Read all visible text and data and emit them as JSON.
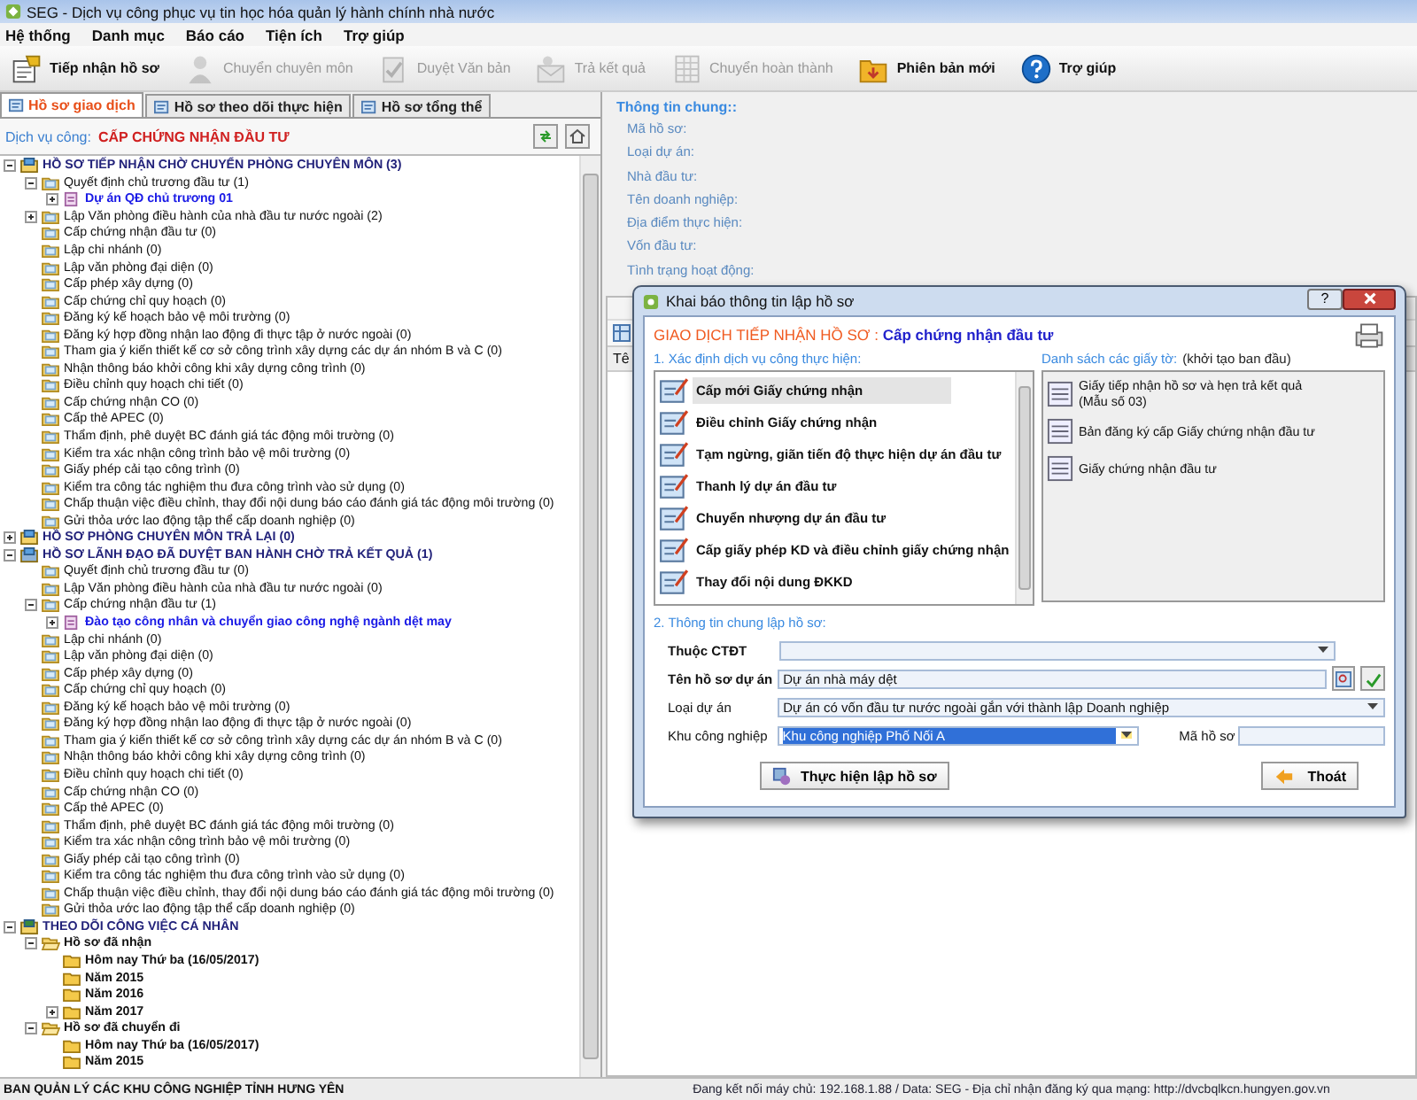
{
  "window": {
    "title": "SEG - Dịch vụ công phục vụ tin học hóa quản lý hành chính nhà nước"
  },
  "menu": [
    "Hệ thống",
    "Danh mục",
    "Báo cáo",
    "Tiện ích",
    "Trợ giúp"
  ],
  "toolbar": [
    {
      "label": "Tiếp nhận hồ sơ",
      "disabled": false
    },
    {
      "label": "Chuyển chuyên môn",
      "disabled": true
    },
    {
      "label": "Duyệt Văn bản",
      "disabled": true
    },
    {
      "label": "Trả kết quả",
      "disabled": true
    },
    {
      "label": "Chuyển hoàn thành",
      "disabled": true
    },
    {
      "label": "Phiên bản mới",
      "disabled": false
    },
    {
      "label": "Trợ giúp",
      "disabled": false
    }
  ],
  "tabs": [
    {
      "label": "Hồ sơ giao dịch",
      "selected": true
    },
    {
      "label": "Hồ sơ theo dõi thực hiện",
      "selected": false
    },
    {
      "label": "Hồ sơ tổng thể",
      "selected": false
    }
  ],
  "service": {
    "label": "Dịch vụ công:",
    "value": "CẤP CHỨNG NHẬN ĐẦU TƯ"
  },
  "tree": {
    "nodes": [
      {
        "label": "HỒ SƠ TIẾP NHẬN CHỜ CHUYỂN PHÒNG CHUYÊN MÔN (3)",
        "kind": "group",
        "expanded": true,
        "children": [
          {
            "label": "Quyết định chủ trương đầu tư (1)",
            "kind": "folder",
            "expanded": true,
            "children": [
              {
                "label": "Dự án QĐ chủ trương 01",
                "kind": "record",
                "expanded": false
              }
            ]
          },
          {
            "label": "Lập Văn phòng điều hành của nhà đầu tư nước ngoài (2)",
            "kind": "folder",
            "expanded": false
          },
          {
            "label": "Cấp chứng nhận đầu tư (0)",
            "kind": "folder"
          },
          {
            "label": "Lập chi nhánh (0)",
            "kind": "folder"
          },
          {
            "label": "Lập văn phòng đại diện (0)",
            "kind": "folder"
          },
          {
            "label": "Cấp phép xây dựng (0)",
            "kind": "folder"
          },
          {
            "label": "Cấp chứng chỉ quy hoạch (0)",
            "kind": "folder"
          },
          {
            "label": "Đăng ký kế hoạch bảo vệ môi trường (0)",
            "kind": "folder"
          },
          {
            "label": "Đăng ký hợp đồng nhận lao động đi thực tập ở nước ngoài (0)",
            "kind": "folder"
          },
          {
            "label": "Tham gia ý kiến thiết kế cơ sở công trình xây dựng các dự án nhóm B và C (0)",
            "kind": "folder"
          },
          {
            "label": "Nhận thông báo khởi công khi xây dựng công trình (0)",
            "kind": "folder"
          },
          {
            "label": "Điều chỉnh quy hoạch chi tiết (0)",
            "kind": "folder"
          },
          {
            "label": "Cấp chứng nhận CO (0)",
            "kind": "folder"
          },
          {
            "label": "Cấp thẻ APEC (0)",
            "kind": "folder"
          },
          {
            "label": "Thẩm định, phê duyệt BC đánh giá tác động môi trường (0)",
            "kind": "folder"
          },
          {
            "label": "Kiểm tra xác nhận công trình bảo vệ môi trường (0)",
            "kind": "folder"
          },
          {
            "label": "Giấy phép cải tạo công trình (0)",
            "kind": "folder"
          },
          {
            "label": "Kiểm tra công tác nghiệm thu đưa công trình vào sử dụng (0)",
            "kind": "folder"
          },
          {
            "label": "Chấp thuận việc điều chỉnh, thay đổi nội dung báo cáo đánh giá tác động môi trường (0)",
            "kind": "folder"
          },
          {
            "label": "Gửi thỏa ước lao động tập thể cấp doanh nghiệp (0)",
            "kind": "folder"
          }
        ]
      },
      {
        "label": "HỒ SƠ PHÒNG CHUYÊN MÔN TRẢ LẠI (0)",
        "kind": "group",
        "expanded": false
      },
      {
        "label": "HỒ SƠ LÃNH ĐẠO ĐÃ DUYỆT BAN HÀNH CHỜ TRẢ KẾT QUẢ (1)",
        "kind": "approved",
        "expanded": true,
        "children": [
          {
            "label": "Quyết định chủ trương đầu tư (0)",
            "kind": "folder"
          },
          {
            "label": "Lập Văn phòng điều hành của nhà đầu tư nước ngoài (0)",
            "kind": "folder"
          },
          {
            "label": "Cấp chứng nhận đầu tư (1)",
            "kind": "folder",
            "expanded": true,
            "children": [
              {
                "label": "Đào tạo công nhân và chuyển giao công nghệ ngành dệt may",
                "kind": "record",
                "expanded": false
              }
            ]
          },
          {
            "label": "Lập chi nhánh (0)",
            "kind": "folder"
          },
          {
            "label": "Lập văn phòng đại diện (0)",
            "kind": "folder"
          },
          {
            "label": "Cấp phép xây dựng (0)",
            "kind": "folder"
          },
          {
            "label": "Cấp chứng chỉ quy hoạch (0)",
            "kind": "folder"
          },
          {
            "label": "Đăng ký kế hoạch bảo vệ môi trường (0)",
            "kind": "folder"
          },
          {
            "label": "Đăng ký hợp đồng nhận lao động đi thực tập ở nước ngoài (0)",
            "kind": "folder"
          },
          {
            "label": "Tham gia ý kiến thiết kế cơ sở công trình xây dựng các dự án nhóm B và C (0)",
            "kind": "folder"
          },
          {
            "label": "Nhận thông báo khởi công khi xây dựng công trình (0)",
            "kind": "folder"
          },
          {
            "label": "Điều chỉnh quy hoạch chi tiết (0)",
            "kind": "folder"
          },
          {
            "label": "Cấp chứng nhận CO (0)",
            "kind": "folder"
          },
          {
            "label": "Cấp thẻ APEC (0)",
            "kind": "folder"
          },
          {
            "label": "Thẩm định, phê duyệt BC đánh giá tác động môi trường (0)",
            "kind": "folder"
          },
          {
            "label": "Kiểm tra xác nhận công trình bảo vệ môi trường (0)",
            "kind": "folder"
          },
          {
            "label": "Giấy phép cải tạo công trình (0)",
            "kind": "folder"
          },
          {
            "label": "Kiểm tra công tác nghiệm thu đưa công trình vào sử dụng (0)",
            "kind": "folder"
          },
          {
            "label": "Chấp thuận việc điều chỉnh, thay đổi nội dung báo cáo đánh giá tác động môi trường (0)",
            "kind": "folder"
          },
          {
            "label": "Gửi thỏa ước lao động tập thể cấp doanh nghiệp (0)",
            "kind": "folder"
          }
        ]
      },
      {
        "label": "THEO DÕI CÔNG VIỆC CÁ NHÂN",
        "kind": "personal",
        "expanded": true,
        "children": [
          {
            "label": "Hồ sơ đã nhận",
            "kind": "inbox",
            "expanded": true,
            "children": [
              {
                "label": "Hôm nay Thứ ba (16/05/2017)",
                "kind": "year"
              },
              {
                "label": "Năm 2015",
                "kind": "year"
              },
              {
                "label": "Năm 2016",
                "kind": "year"
              },
              {
                "label": "Năm 2017",
                "kind": "year",
                "expanded": false
              }
            ]
          },
          {
            "label": "Hồ sơ đã chuyển đi",
            "kind": "inbox",
            "expanded": true,
            "children": [
              {
                "label": "Hôm nay Thứ ba (16/05/2017)",
                "kind": "year"
              },
              {
                "label": "Năm 2015",
                "kind": "year"
              }
            ]
          }
        ]
      }
    ]
  },
  "info": {
    "title": "Thông tin chung::",
    "fields": [
      "Mã hồ sơ:",
      "Loại dự án:",
      "Nhà đầu tư:",
      "Tên doanh nghiệp:",
      "Địa điểm thực hiện:",
      "Vốn đầu tư:",
      "Tình trạng hoạt động:"
    ]
  },
  "grid": {
    "column_1": "Tê"
  },
  "dialog": {
    "title": "Khai báo thông tin lập hồ sơ",
    "help_button": "?",
    "heading": "GIAO DỊCH TIẾP NHẬN HỒ SƠ :",
    "heading_value": "Cấp chứng nhận đầu tư",
    "services_title": "1. Xác định dịch vụ công thực hiện:",
    "services": [
      {
        "label": "Cấp mới Giấy chứng nhận",
        "selected": true
      },
      {
        "label": "Điều chỉnh Giấy chứng nhận",
        "selected": false
      },
      {
        "label": "Tạm ngừng, giãn tiến độ thực hiện dự án đầu tư",
        "selected": false
      },
      {
        "label": "Thanh lý dự án đầu tư",
        "selected": false
      },
      {
        "label": "Chuyển nhượng dự án đầu tư",
        "selected": false
      },
      {
        "label": "Cấp giấy phép KD và điều chỉnh giấy chứng nhận",
        "selected": false
      },
      {
        "label": "Thay đổi nội dung ĐKKD",
        "selected": false
      }
    ],
    "documents_title": "Danh sách các giấy tờ:",
    "documents_note": "(khởi tạo ban đầu)",
    "documents": [
      [
        "Giấy tiếp nhận hồ sơ và hẹn trả kết quả",
        "(Mẫu số 03)"
      ],
      [
        "Bản đăng ký cấp Giấy chứng nhận đầu tư"
      ],
      [
        "Giấy chứng nhận đầu tư"
      ]
    ],
    "form_title": "2. Thông tin chung lập hồ sơ:",
    "program": {
      "label": "Thuộc CTĐT"
    },
    "project_name": {
      "label": "Tên hồ sơ dự án",
      "value": "Dự án nhà máy dệt"
    },
    "project_type": {
      "label": "Loại dự án",
      "value": "Dự án có vốn đầu tư nước ngoài gắn với thành lập Doanh nghiệp"
    },
    "industrial_zone": {
      "label": "Khu công nghiệp",
      "value": "Khu công nghiệp Phố Nối A",
      "focused": true
    },
    "file_code": {
      "label": "Mã hồ sơ"
    },
    "buttons": [
      "Thực hiện lập hồ sơ",
      "Thoát"
    ]
  },
  "status_bar": {
    "left": "BAN QUẢN LÝ CÁC KHU CÔNG NGHIỆP TỈNH HƯNG YÊN",
    "right": "Đang kết nối máy chủ: 192.168.1.88 / Data: SEG - Địa chỉ nhận đăng ký qua mạng: http://dvcbqlkcn.hungyen.gov.vn"
  }
}
